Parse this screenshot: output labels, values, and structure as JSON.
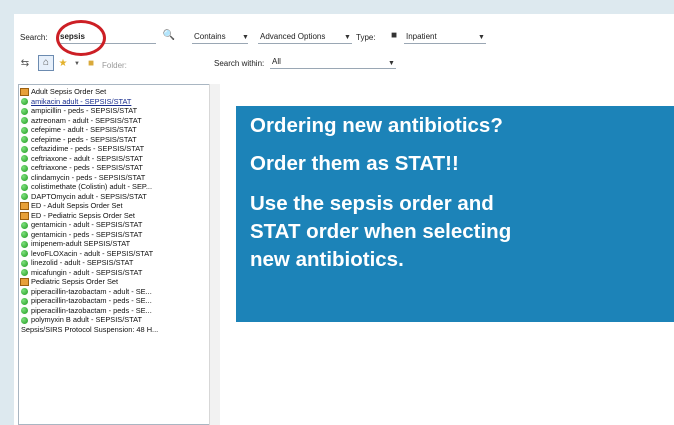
{
  "search": {
    "label": "Search:",
    "value": "sepsis"
  },
  "toolbar": {
    "match_mode": "Contains",
    "advanced_options": "Advanced Options",
    "type_label": "Type:",
    "type_value": "Inpatient",
    "folder_label": "Folder:",
    "search_within_label": "Search within:",
    "search_within_value": "All"
  },
  "results": [
    {
      "kind": "set",
      "label": "Adult Sepsis Order Set"
    },
    {
      "kind": "item",
      "label": "amikacin adult - SEPSIS/STAT",
      "selected": true
    },
    {
      "kind": "item",
      "label": "ampicillin - peds - SEPSIS/STAT"
    },
    {
      "kind": "item",
      "label": "aztreonam - adult - SEPSIS/STAT"
    },
    {
      "kind": "item",
      "label": "cefepime - adult - SEPSIS/STAT"
    },
    {
      "kind": "item",
      "label": "cefepime - peds - SEPSIS/STAT"
    },
    {
      "kind": "item",
      "label": "ceftazidime - peds - SEPSIS/STAT"
    },
    {
      "kind": "item",
      "label": "ceftriaxone - adult - SEPSIS/STAT"
    },
    {
      "kind": "item",
      "label": "ceftriaxone - peds - SEPSIS/STAT"
    },
    {
      "kind": "item",
      "label": "clindamycin - peds - SEPSIS/STAT"
    },
    {
      "kind": "item",
      "label": "colistimethate (Colistin) adult - SEP..."
    },
    {
      "kind": "item",
      "label": "DAPTOmycin adult - SEPSIS/STAT"
    },
    {
      "kind": "set",
      "label": "ED - Adult Sepsis Order Set"
    },
    {
      "kind": "set",
      "label": "ED - Pediatric Sepsis Order Set"
    },
    {
      "kind": "item",
      "label": "gentamicin - adult - SEPSIS/STAT"
    },
    {
      "kind": "item",
      "label": "gentamicin - peds - SEPSIS/STAT"
    },
    {
      "kind": "item",
      "label": "imipenem-adult SEPSIS/STAT"
    },
    {
      "kind": "item",
      "label": "levoFLOXacin - adult - SEPSIS/STAT"
    },
    {
      "kind": "item",
      "label": "linezolid - adult - SEPSIS/STAT"
    },
    {
      "kind": "item",
      "label": "micafungin - adult - SEPSIS/STAT"
    },
    {
      "kind": "set",
      "label": "Pediatric Sepsis Order Set"
    },
    {
      "kind": "item",
      "label": "piperacillin-tazobactam - adult - SE..."
    },
    {
      "kind": "item",
      "label": "piperacillin-tazobactam - peds - SE..."
    },
    {
      "kind": "item",
      "label": "piperacillin-tazobactam - peds - SE..."
    },
    {
      "kind": "item",
      "label": "polymyxin B adult - SEPSIS/STAT"
    },
    {
      "kind": "plain",
      "label": "Sepsis/SIRS Protocol Suspension: 48 H..."
    }
  ],
  "banner": {
    "line1": "Ordering new antibiotics?",
    "line2": "Order them as STAT!!",
    "line3": "Use the sepsis order and",
    "line4": "STAT order when selecting",
    "line5": "new antibiotics."
  },
  "colors": {
    "banner_bg": "#1c83b8",
    "highlight": "#cc1f25",
    "page_bg": "#dde9ef"
  }
}
